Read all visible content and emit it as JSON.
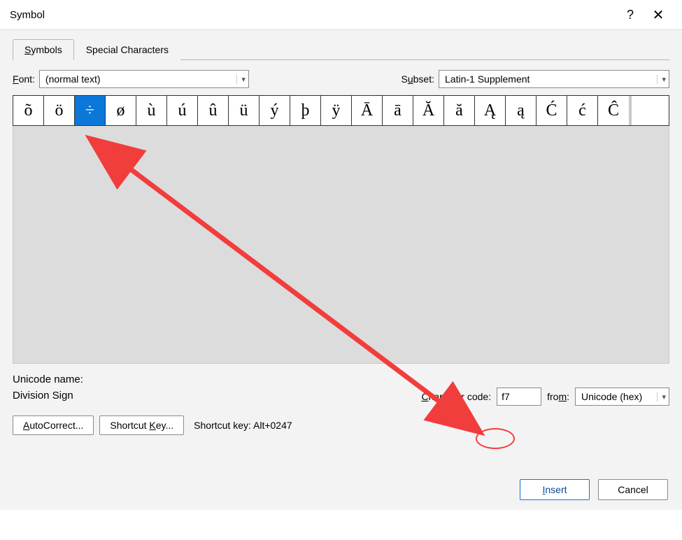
{
  "window": {
    "title": "Symbol",
    "help": "?",
    "close": "✕"
  },
  "tabs": {
    "symbols": "ymbols",
    "symbols_prefix": "S",
    "special": "Special Characters"
  },
  "font": {
    "label_prefix": "F",
    "label": "ont:",
    "value": "(normal text)"
  },
  "subset": {
    "label_prefix": "S",
    "label": "ubset:",
    "value": "Latin-1 Supplement"
  },
  "symbols_row": [
    "õ",
    "ö",
    "÷",
    "ø",
    "ù",
    "ú",
    "û",
    "ü",
    "ý",
    "þ",
    "ÿ",
    "Ā",
    "ā",
    "Ă",
    "ă",
    "Ą",
    "ą",
    "Ć",
    "ć",
    "Ĉ"
  ],
  "selected_index": 2,
  "unicode_name": {
    "label": "Unicode name:",
    "value": "Division Sign"
  },
  "charcode": {
    "label_prefix": "C",
    "label": "haracter code:",
    "value": "f7"
  },
  "from": {
    "label": "fro",
    "label_suffix": "m",
    "label_colon": ":",
    "value": "Unicode (hex)"
  },
  "buttons": {
    "autocorrect_prefix": "A",
    "autocorrect": "utoCorrect...",
    "shortcutkey": "Shortcut ",
    "shortcutkey_u": "K",
    "shortcutkey_suffix": "ey..."
  },
  "shortcut_display": {
    "label": "Shortcut key:",
    "value": "Alt+0247"
  },
  "footer": {
    "insert_prefix": "I",
    "insert": "nsert",
    "cancel": "Cancel"
  }
}
